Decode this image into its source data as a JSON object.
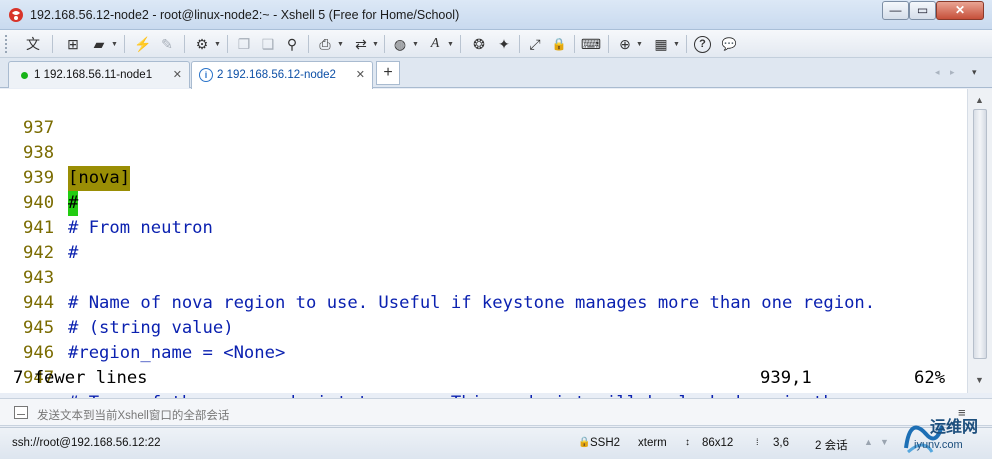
{
  "window": {
    "title": "192.168.56.12-node2 - root@linux-node2:~ - Xshell 5 (Free for Home/School)",
    "controls": {
      "minimize": "—",
      "maximize": "▭",
      "close": "✕"
    }
  },
  "toolbar": {
    "buttons": [
      {
        "name": "language-icon",
        "glyph": "文"
      },
      {
        "name": "new-session-icon",
        "glyph": "⊞"
      },
      {
        "name": "open-folder-icon",
        "glyph": "▰"
      },
      {
        "name": "connect-icon",
        "glyph": "⚡"
      },
      {
        "name": "disconnect-icon",
        "glyph": "✎"
      },
      {
        "name": "properties-icon",
        "glyph": "⚙"
      },
      {
        "name": "copy-icon",
        "glyph": "❐"
      },
      {
        "name": "paste-icon",
        "glyph": "❑"
      },
      {
        "name": "find-icon",
        "glyph": "⚲"
      },
      {
        "name": "print-icon",
        "glyph": "⎙"
      },
      {
        "name": "transfer-icon",
        "glyph": "⇄"
      },
      {
        "name": "globe-icon",
        "glyph": "◍"
      },
      {
        "name": "font-icon",
        "glyph": "A"
      },
      {
        "name": "xftp-icon",
        "glyph": "❂"
      },
      {
        "name": "script-icon",
        "glyph": "✦"
      },
      {
        "name": "fullscreen-icon",
        "glyph": "⤢"
      },
      {
        "name": "lock-icon",
        "glyph": "🔒"
      },
      {
        "name": "keyboard-icon",
        "glyph": "⌨"
      },
      {
        "name": "add-icon",
        "glyph": "⊕"
      },
      {
        "name": "layout-icon",
        "glyph": "▦"
      },
      {
        "name": "help-icon",
        "glyph": "?"
      },
      {
        "name": "chat-icon",
        "glyph": "💬"
      }
    ]
  },
  "tabs": [
    {
      "label": "1 192.168.56.11-node1",
      "status": "connected",
      "active": false
    },
    {
      "label": "2 192.168.56.12-node2",
      "status": "info",
      "active": true
    }
  ],
  "tab_controls": {
    "close": "✕",
    "add": "+",
    "prev": "◂",
    "next": "▸",
    "menu": "▾"
  },
  "terminal": {
    "lines": [
      {
        "num": "937",
        "text": ""
      },
      {
        "num": "938",
        "text": "[nova]"
      },
      {
        "num": "939",
        "text": "#"
      },
      {
        "num": "940",
        "text": "# From neutron"
      },
      {
        "num": "941",
        "text": "#"
      },
      {
        "num": "942",
        "text": ""
      },
      {
        "num": "943",
        "text": "# Name of nova region to use. Useful if keystone manages more than one region."
      },
      {
        "num": "944",
        "text": "# (string value)"
      },
      {
        "num": "945",
        "text": "#region_name = <None>"
      },
      {
        "num": "946",
        "text": ""
      },
      {
        "num": "947",
        "text": "# Type of the nova endpoint to use.  This endpoint will be looked up in the"
      }
    ],
    "status_message": "7 fewer lines",
    "cursor_position": "939,1",
    "scroll_percent": "62%",
    "colors": {
      "line_number": "#7a6b00",
      "text": "#0b21b0",
      "bracket_highlight": "#9a8e05",
      "cursor": "#22cc11"
    }
  },
  "compose": {
    "placeholder": "发送文本到当前Xshell窗口的全部会话",
    "menu_glyph": "≡"
  },
  "statusbar": {
    "connection": "ssh://root@192.168.56.12:22",
    "protocol": "SSH2",
    "terminal_type": "xterm",
    "size": "86x12",
    "cursor": "3,6",
    "sessions": "2 会话"
  },
  "watermark": {
    "text": "运维网",
    "sub": "iyunv.com"
  }
}
